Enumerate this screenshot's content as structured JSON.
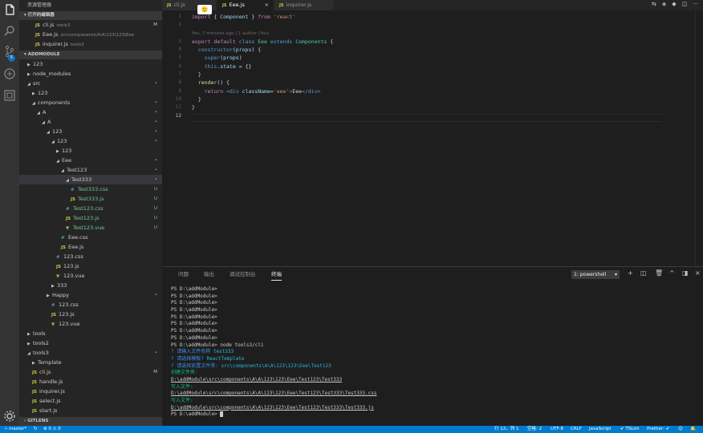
{
  "activity": {
    "icons": [
      "files-icon",
      "search-icon",
      "source-control-icon",
      "debug-icon",
      "extensions-icon",
      "gear-icon"
    ],
    "scm_badge": "5"
  },
  "sidebar": {
    "title": "资源管理器",
    "open_editors_header": "打开的编辑器",
    "open_editors": [
      {
        "name": "cli.js",
        "desc": "tools3",
        "status": "M"
      },
      {
        "name": "Eee.js",
        "desc": "src\\components\\A\\A\\123\\123\\Eee",
        "status": ""
      },
      {
        "name": "inquirer.js",
        "desc": "tools3",
        "status": ""
      }
    ],
    "project_header": "ADDMODULE",
    "tree": [
      {
        "label": "123",
        "indent": 0,
        "type": "folder",
        "open": false,
        "status": ""
      },
      {
        "label": "node_modules",
        "indent": 0,
        "type": "folder",
        "open": false,
        "status": ""
      },
      {
        "label": "src",
        "indent": 0,
        "type": "folder",
        "open": true,
        "status": "•"
      },
      {
        "label": "123",
        "indent": 1,
        "type": "folder",
        "open": false,
        "status": ""
      },
      {
        "label": "components",
        "indent": 1,
        "type": "folder",
        "open": true,
        "status": "•"
      },
      {
        "label": "A",
        "indent": 2,
        "type": "folder",
        "open": true,
        "status": "•"
      },
      {
        "label": "A",
        "indent": 3,
        "type": "folder",
        "open": true,
        "status": "•"
      },
      {
        "label": "123",
        "indent": 4,
        "type": "folder",
        "open": true,
        "status": "•"
      },
      {
        "label": "123",
        "indent": 5,
        "type": "folder",
        "open": true,
        "status": "•"
      },
      {
        "label": "123",
        "indent": 6,
        "type": "folder",
        "open": false,
        "status": ""
      },
      {
        "label": "Eee",
        "indent": 6,
        "type": "folder",
        "open": true,
        "status": "•"
      },
      {
        "label": "Test123",
        "indent": 7,
        "type": "folder",
        "open": true,
        "status": "•"
      },
      {
        "label": "Test333",
        "indent": 8,
        "type": "folder",
        "open": true,
        "status": "•",
        "selected": true
      },
      {
        "label": "Test333.css",
        "indent": 9,
        "type": "css",
        "status": "U"
      },
      {
        "label": "Test333.js",
        "indent": 9,
        "type": "js",
        "status": "U"
      },
      {
        "label": "Test123.css",
        "indent": 8,
        "type": "css",
        "status": "U"
      },
      {
        "label": "Test123.js",
        "indent": 8,
        "type": "js",
        "status": "U"
      },
      {
        "label": "Test123.vue",
        "indent": 8,
        "type": "vue",
        "status": "U"
      },
      {
        "label": "Eee.css",
        "indent": 7,
        "type": "css",
        "status": ""
      },
      {
        "label": "Eee.js",
        "indent": 7,
        "type": "js",
        "status": ""
      },
      {
        "label": "123.css",
        "indent": 6,
        "type": "css",
        "status": ""
      },
      {
        "label": "123.js",
        "indent": 6,
        "type": "js",
        "status": ""
      },
      {
        "label": "123.vue",
        "indent": 6,
        "type": "vue",
        "status": ""
      },
      {
        "label": "333",
        "indent": 5,
        "type": "folder",
        "open": false,
        "status": ""
      },
      {
        "label": "Happy",
        "indent": 4,
        "type": "folder",
        "open": false,
        "status": "•"
      },
      {
        "label": "123.css",
        "indent": 5,
        "type": "css",
        "status": ""
      },
      {
        "label": "123.js",
        "indent": 5,
        "type": "js",
        "status": ""
      },
      {
        "label": "123.vue",
        "indent": 5,
        "type": "vue",
        "status": ""
      },
      {
        "label": "tools",
        "indent": 0,
        "type": "folder",
        "open": false,
        "status": ""
      },
      {
        "label": "tools2",
        "indent": 0,
        "type": "folder",
        "open": false,
        "status": ""
      },
      {
        "label": "tools3",
        "indent": 0,
        "type": "folder",
        "open": true,
        "status": "•"
      },
      {
        "label": "Template",
        "indent": 1,
        "type": "folder",
        "open": false,
        "status": ""
      },
      {
        "label": "cli.js",
        "indent": 1,
        "type": "js",
        "status": "M"
      },
      {
        "label": "handle.js",
        "indent": 1,
        "type": "js",
        "status": ""
      },
      {
        "label": "inquirer.js",
        "indent": 1,
        "type": "js",
        "status": ""
      },
      {
        "label": "select.js",
        "indent": 1,
        "type": "js",
        "status": ""
      },
      {
        "label": "start.js",
        "indent": 1,
        "type": "js",
        "status": ""
      }
    ],
    "gitlens_header": "GITLENS"
  },
  "tabs": [
    {
      "label": "cli.js",
      "active": false
    },
    {
      "label": "Eee.js",
      "active": true
    },
    {
      "label": "inquirer.js",
      "active": false
    }
  ],
  "editor": {
    "line_numbers": [
      "1",
      "2",
      "3",
      "4",
      "5",
      "6",
      "7",
      "8",
      "9",
      "10",
      "11",
      "12"
    ],
    "blame": "You, 7 minutes ago | 1 author (You)",
    "hint_glyph": "🙂"
  },
  "panel": {
    "tabs": [
      "问题",
      "输出",
      "调试控制台",
      "终端"
    ],
    "active_tab": "终端",
    "terminal_select": "1: powershell",
    "lines": [
      {
        "kind": "plain",
        "text": "PS D:\\addModule>"
      },
      {
        "kind": "plain",
        "text": "PS D:\\addModule>"
      },
      {
        "kind": "plain",
        "text": "PS D:\\addModule>"
      },
      {
        "kind": "plain",
        "text": "PS D:\\addModule>"
      },
      {
        "kind": "plain",
        "text": "PS D:\\addModule>"
      },
      {
        "kind": "plain",
        "text": "PS D:\\addModule>"
      },
      {
        "kind": "plain",
        "text": "PS D:\\addModule>"
      },
      {
        "kind": "plain",
        "text": "PS D:\\addModule>"
      },
      {
        "kind": "plain",
        "text": "PS D:\\addModule> node tools3/cli"
      },
      {
        "kind": "q",
        "q": "? 请输入文件名称",
        "a": "test333"
      },
      {
        "kind": "q",
        "q": "? 请选择模板?",
        "a": "ReactTemplate"
      },
      {
        "kind": "q",
        "q": "? 请选择放置文件夹:",
        "a": "src\\components\\A\\A\\123\\123\\Eee\\Test123"
      },
      {
        "kind": "g",
        "text": "创建文件夹:"
      },
      {
        "kind": "u",
        "text": "D:\\addModule\\src\\components\\A\\A\\123\\123\\Eee\\Test123\\Test333"
      },
      {
        "kind": "g",
        "text": "写入文件:"
      },
      {
        "kind": "u",
        "text": "D:\\addModule\\src\\components\\A\\A\\123\\123\\Eee\\Test123\\Test333\\Test333.css"
      },
      {
        "kind": "g",
        "text": "写入文件:"
      },
      {
        "kind": "u",
        "text": "D:\\addModule\\src\\components\\A\\A\\123\\123\\Eee\\Test123\\Test333\\Test333.js"
      },
      {
        "kind": "cursor",
        "text": "PS D:\\addModule>"
      }
    ]
  },
  "status": {
    "branch": "master*",
    "sync": "↻",
    "problems": "⊗ 0  ⚠ 0",
    "position": "行 12，列 1",
    "spaces": "空格: 2",
    "encoding": "UTF-8",
    "eol": "CRLF",
    "language": "JavaScript",
    "lint": "✔ TSLint",
    "prettier": "Prettier: ✔",
    "smiley": "☺",
    "bell": "🔔"
  },
  "colors": {
    "accent": "#007acc",
    "js": "#cbcb41",
    "css": "#519aba",
    "vue": "#8dc149",
    "untracked": "#73c991",
    "modified": "#e2c08d"
  }
}
